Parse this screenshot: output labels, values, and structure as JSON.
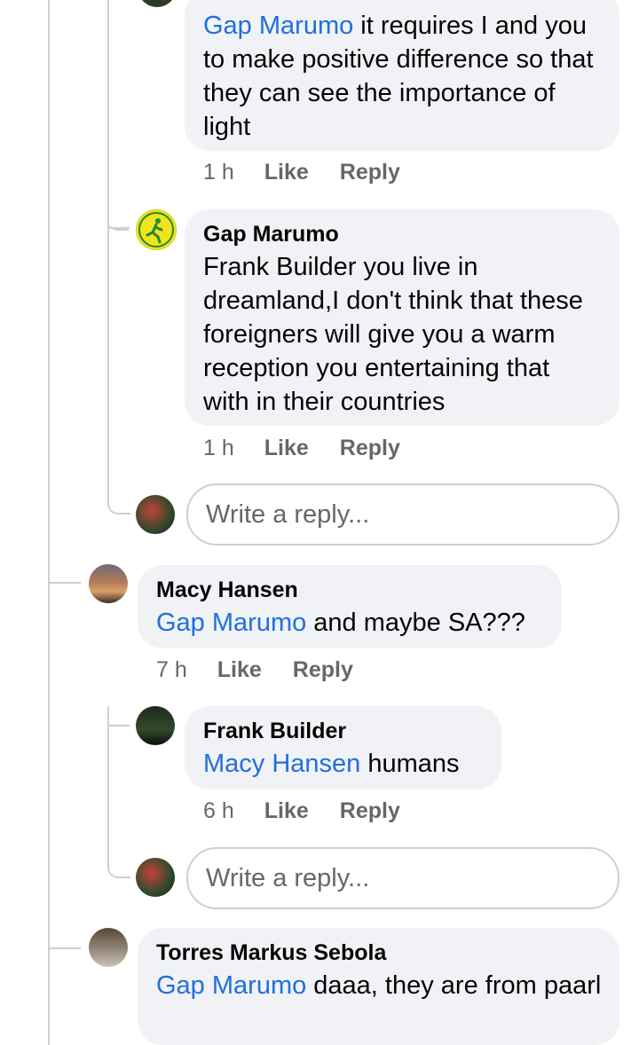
{
  "comments": [
    {
      "mention": "Gap Marumo",
      "text": " it requires I and you to make positive difference so that they can see the importance of light",
      "time": "1 h",
      "like": "Like",
      "reply": "Reply"
    },
    {
      "author": "Gap Marumo",
      "text": "Frank Builder you live in dreamland,I don't think that these foreigners will give you a warm reception you entertaining that with in their countries",
      "time": "1 h",
      "like": "Like",
      "reply": "Reply"
    },
    {
      "author": "Macy Hansen",
      "mention": "Gap Marumo",
      "text": " and maybe SA???",
      "time": "7 h",
      "like": "Like",
      "reply": "Reply"
    },
    {
      "author": "Frank Builder",
      "mention": "Macy Hansen",
      "text": " humans",
      "time": "6 h",
      "like": "Like",
      "reply": "Reply"
    },
    {
      "author": "Torres Markus Sebola",
      "mention": "Gap Marumo",
      "text": " daaa,  they are from paarl"
    }
  ],
  "reply_box": {
    "placeholder": "Write a reply..."
  },
  "colors": {
    "mention": "#216fdb",
    "bubble": "#f0f2f5",
    "meta": "#65676b"
  }
}
